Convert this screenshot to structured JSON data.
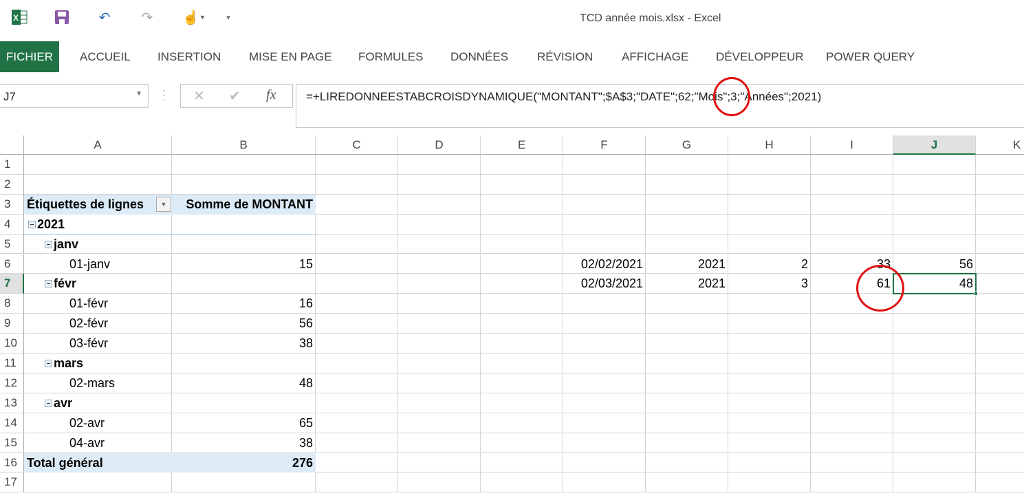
{
  "window": {
    "title": "TCD année mois.xlsx - Excel"
  },
  "qat": {
    "icons": [
      "excel-logo-icon",
      "save-icon",
      "undo-icon",
      "redo-icon",
      "touch-mode-icon",
      "customize-qat-icon"
    ]
  },
  "ribbon": {
    "tabs": [
      "FICHIER",
      "ACCUEIL",
      "INSERTION",
      "MISE EN PAGE",
      "FORMULES",
      "DONNÉES",
      "RÉVISION",
      "AFFICHAGE",
      "DÉVELOPPEUR",
      "POWER QUERY"
    ]
  },
  "formula_bar": {
    "name_box": "J7",
    "cancel": "✕",
    "enter": "✔",
    "fx": "fx",
    "formula": "=+LIREDONNEESTABCROISDYNAMIQUE(\"MONTANT\";$A$3;\"DATE\";62;\"Mois\";3;\"Années\";2021)"
  },
  "columns": [
    "A",
    "B",
    "C",
    "D",
    "E",
    "F",
    "G",
    "H",
    "I",
    "J",
    "K"
  ],
  "rows": [
    "1",
    "2",
    "3",
    "4",
    "5",
    "6",
    "7",
    "8",
    "9",
    "10",
    "11",
    "12",
    "13",
    "14",
    "15",
    "16",
    "17"
  ],
  "pivot": {
    "header_label": "Étiquettes de lignes",
    "header_value": "Somme de MONTANT",
    "rows": [
      {
        "label": "2021",
        "value": "",
        "level": 0,
        "bold": true,
        "toggle": true
      },
      {
        "label": "janv",
        "value": "",
        "level": 1,
        "bold": true,
        "toggle": true
      },
      {
        "label": "01-janv",
        "value": "15",
        "level": 2
      },
      {
        "label": "févr",
        "value": "",
        "level": 1,
        "bold": true,
        "toggle": true
      },
      {
        "label": "01-févr",
        "value": "16",
        "level": 2
      },
      {
        "label": "02-févr",
        "value": "56",
        "level": 2
      },
      {
        "label": "03-févr",
        "value": "38",
        "level": 2
      },
      {
        "label": "mars",
        "value": "",
        "level": 1,
        "bold": true,
        "toggle": true
      },
      {
        "label": "02-mars",
        "value": "48",
        "level": 2
      },
      {
        "label": "avr",
        "value": "",
        "level": 1,
        "bold": true,
        "toggle": true
      },
      {
        "label": "02-avr",
        "value": "65",
        "level": 2
      },
      {
        "label": "04-avr",
        "value": "38",
        "level": 2
      }
    ],
    "total_label": "Total général",
    "total_value": "276"
  },
  "side_table": [
    {
      "row": 6,
      "F": "02/02/2021",
      "G": "2021",
      "H": "2",
      "I": "33",
      "J": "56"
    },
    {
      "row": 7,
      "F": "02/03/2021",
      "G": "2021",
      "H": "3",
      "I": "61",
      "J": "48"
    }
  ],
  "annotation_color": "#e01010",
  "accent": "#217346"
}
